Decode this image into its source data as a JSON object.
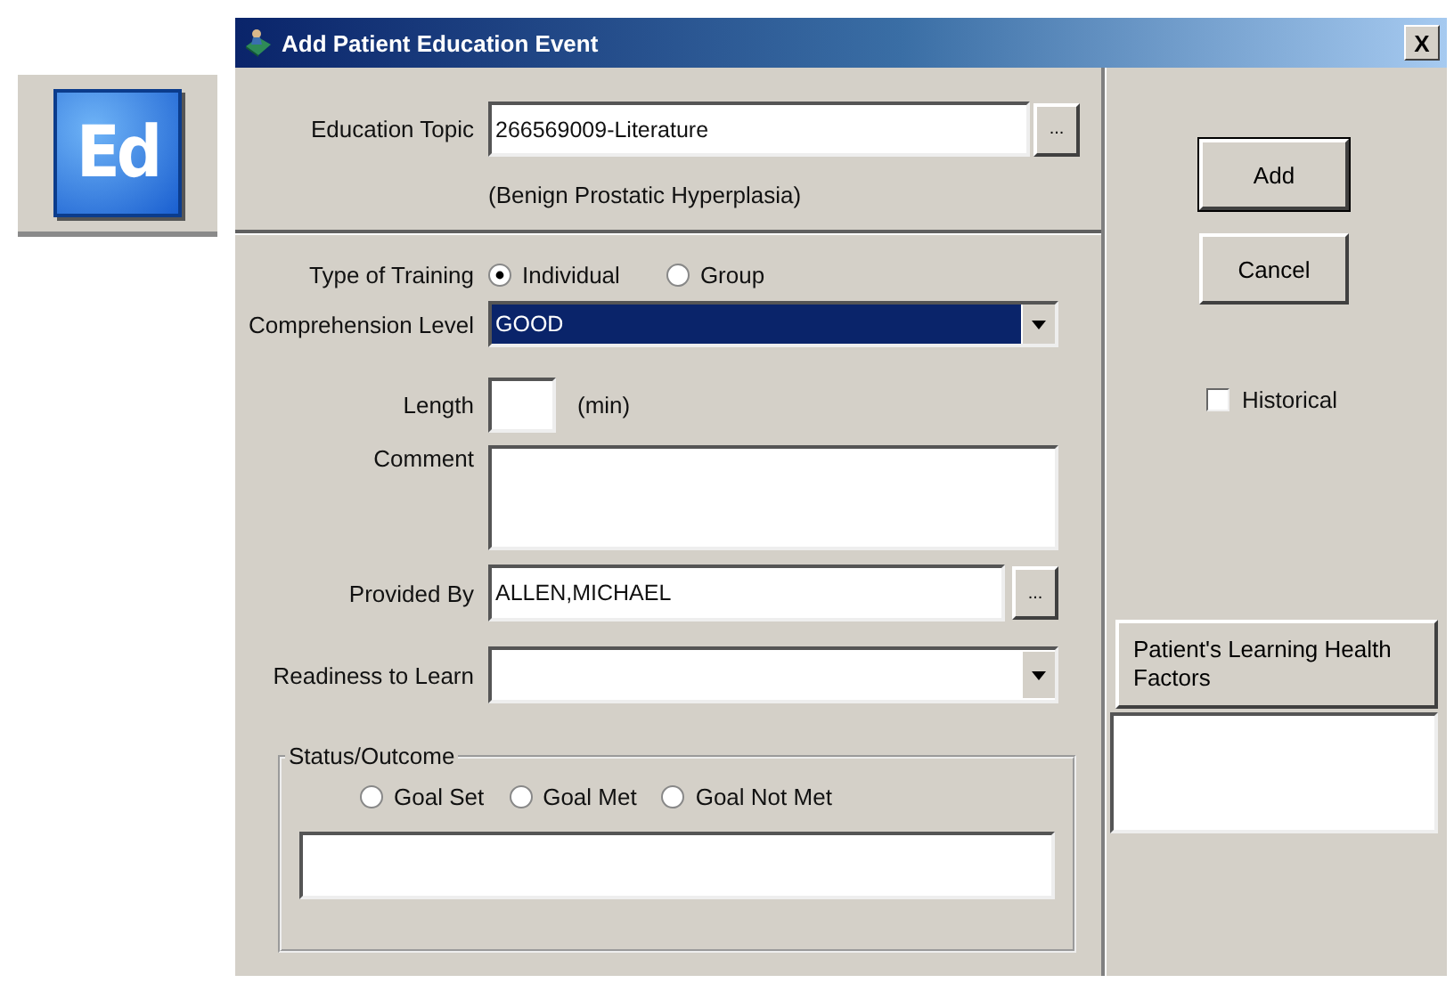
{
  "app_icon": {
    "text": "Ed"
  },
  "window": {
    "title": "Add Patient Education Event",
    "close": "X"
  },
  "education_topic": {
    "label": "Education Topic",
    "value": "266569009-Literature",
    "button": "...",
    "description": "(Benign Prostatic Hyperplasia)"
  },
  "type_of_training": {
    "label": "Type of Training",
    "options": [
      {
        "label": "Individual",
        "selected": true
      },
      {
        "label": "Group",
        "selected": false
      }
    ]
  },
  "comprehension_level": {
    "label": "Comprehension Level",
    "value": "GOOD"
  },
  "length": {
    "label": "Length",
    "unit": "(min)"
  },
  "comment": {
    "label": "Comment"
  },
  "provided_by": {
    "label": "Provided By",
    "value": "ALLEN,MICHAEL",
    "button": "..."
  },
  "readiness_to_learn": {
    "label": "Readiness to Learn"
  },
  "status_outcome": {
    "label": "Status/Outcome",
    "options": [
      {
        "label": "Goal Set",
        "selected": false
      },
      {
        "label": "Goal Met",
        "selected": false
      },
      {
        "label": "Goal Not Met",
        "selected": false
      }
    ]
  },
  "buttons": [
    "Add",
    "Cancel"
  ],
  "historical": {
    "label": "Historical",
    "checked": false
  },
  "learning_factors": {
    "button": "Patient's Learning Health Factors"
  }
}
